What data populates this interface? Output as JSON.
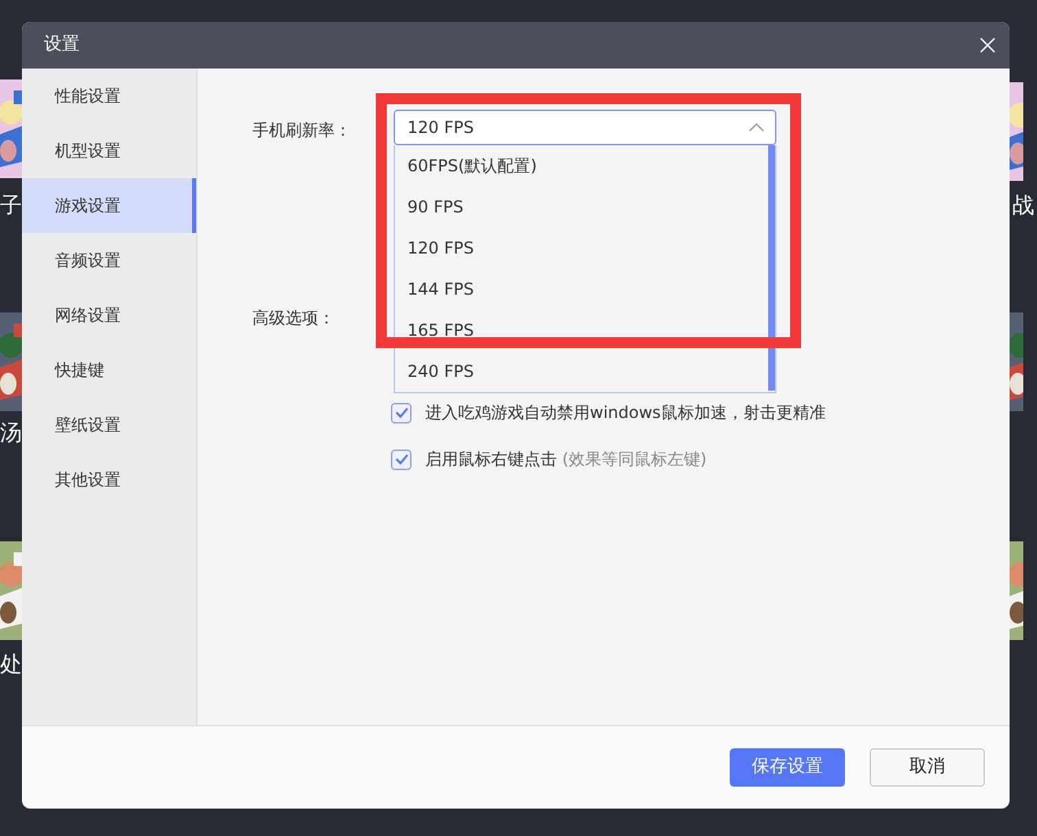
{
  "background": {
    "left_labels": [
      "子",
      "汤",
      "处"
    ],
    "right_labels": [
      "战"
    ]
  },
  "dialog": {
    "title": "设置",
    "sidebar": {
      "items": [
        {
          "label": "性能设置",
          "selected": false
        },
        {
          "label": "机型设置",
          "selected": false
        },
        {
          "label": "游戏设置",
          "selected": true
        },
        {
          "label": "音频设置",
          "selected": false
        },
        {
          "label": "网络设置",
          "selected": false
        },
        {
          "label": "快捷键",
          "selected": false
        },
        {
          "label": "壁纸设置",
          "selected": false
        },
        {
          "label": "其他设置",
          "selected": false
        }
      ]
    },
    "refresh_rate": {
      "label": "手机刷新率：",
      "value": "120 FPS",
      "expanded": true,
      "options": [
        "60FPS(默认配置)",
        "90 FPS",
        "120 FPS",
        "144 FPS",
        "165 FPS",
        "240 FPS"
      ]
    },
    "advanced": {
      "label": "高级选项：",
      "checkboxes": [
        {
          "label": "进入吃鸡游戏自动禁用windows鼠标加速，射击更精准",
          "checked": true
        },
        {
          "label": "启用鼠标右键点击",
          "hint": "(效果等同鼠标左键)",
          "checked": true
        }
      ]
    },
    "buttons": [
      {
        "label": "保存设置",
        "kind": "primary"
      },
      {
        "label": "取消",
        "kind": "secondary"
      }
    ]
  }
}
